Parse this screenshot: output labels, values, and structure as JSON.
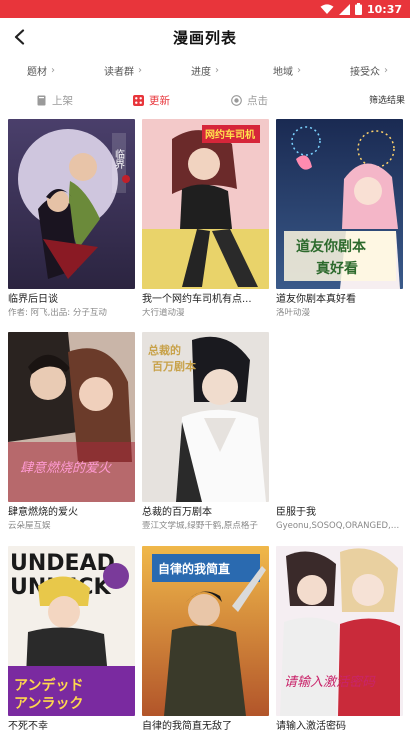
{
  "status": {
    "time": "10:37",
    "accent": "#e8353b"
  },
  "header": {
    "title": "漫画列表",
    "back_icon": "chevron-left-icon"
  },
  "filters": [
    {
      "label": "题材"
    },
    {
      "label": "读者群"
    },
    {
      "label": "进度"
    },
    {
      "label": "地域"
    },
    {
      "label": "接受众"
    }
  ],
  "sort": {
    "options": [
      {
        "label": "上架",
        "icon": "shelf-icon",
        "active": false
      },
      {
        "label": "更新",
        "icon": "refresh-icon",
        "active": true
      },
      {
        "label": "点击",
        "icon": "radio-icon",
        "active": false
      }
    ],
    "filter_result": "筛选结果"
  },
  "comics": [
    {
      "title": "临界后日谈",
      "author": "作者: 阿飞,出品: 分子互动",
      "cover_title": "临界后日谈"
    },
    {
      "title": "我一个网约车司机有点...",
      "author": "大行道动漫",
      "cover_title": "网约车司机"
    },
    {
      "title": "道友你剧本真好看",
      "author": "洛叶动漫",
      "cover_title": "道友你剧本真好看"
    },
    {
      "title": "肆意燃烧的爱火",
      "author": "云朵屋互娱",
      "cover_title": "肆意燃烧的爱火"
    },
    {
      "title": "总裁的百万剧本",
      "author": "壹江文学城,绿野千鹤,原点格子",
      "cover_title": "总裁的百万剧本"
    },
    {
      "title": "臣服于我",
      "author": "Gyeonu,SOSOQ,ORANGED,极直",
      "cover_title": ""
    },
    {
      "title": "不死不幸",
      "author": "",
      "cover_title": "UNDEAD UNLUCK"
    },
    {
      "title": "自律的我简直无敌了",
      "author": "",
      "cover_title": "自律的我简直无敌了"
    },
    {
      "title": "请输入激活密码",
      "author": "",
      "cover_title": "请输入激活密码"
    }
  ]
}
